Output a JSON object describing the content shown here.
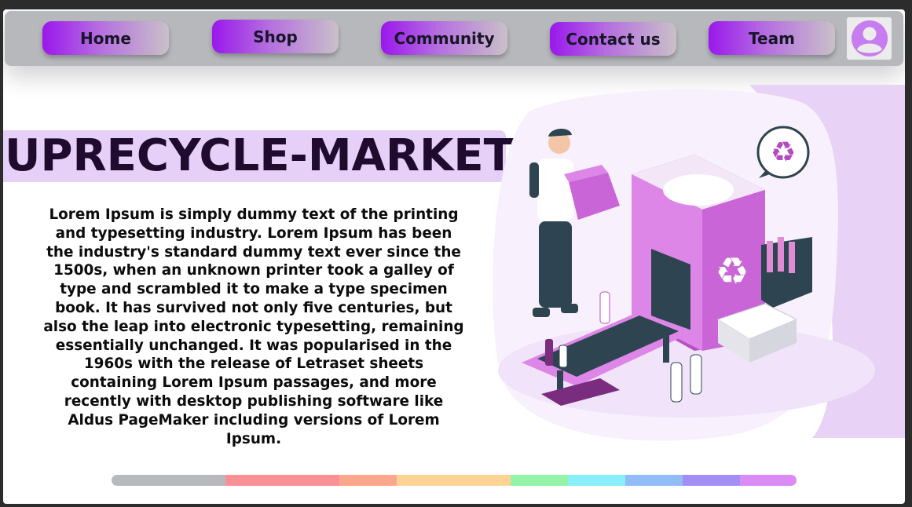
{
  "nav": {
    "items": [
      {
        "label": "Home"
      },
      {
        "label": "Shop"
      },
      {
        "label": "Community"
      },
      {
        "label": "Contact us"
      },
      {
        "label": "Team"
      }
    ],
    "avatar_icon": "user-avatar-icon"
  },
  "hero": {
    "title": "UPRECYCLE-MARKET",
    "body": "Lorem Ipsum is simply dummy text of the printing and typesetting industry. Lorem Ipsum has been the industry's standard dummy text ever since the 1500s, when an unknown printer took a galley of type and scrambled it to make a type specimen book. It has survived not only five centuries, but also the leap into electronic typesetting, remaining essentially unchanged. It was popularised in the 1960s with the release of Letraset sheets containing Lorem Ipsum passages, and more recently with desktop publishing software like Aldus PageMaker including versions of Lorem Ipsum."
  },
  "illustration": {
    "subject": "recycling-worker-illustration",
    "icon": "recycle-icon"
  },
  "colors": {
    "accent": "#9a18ec",
    "title_bg": "#e6d0f7",
    "stripe": [
      "#b8b9bd",
      "#fd8f96",
      "#fda88c",
      "#fdd494",
      "#93f4a8",
      "#8aeefb",
      "#90bdf9",
      "#a28ef6",
      "#db8bf8"
    ]
  }
}
